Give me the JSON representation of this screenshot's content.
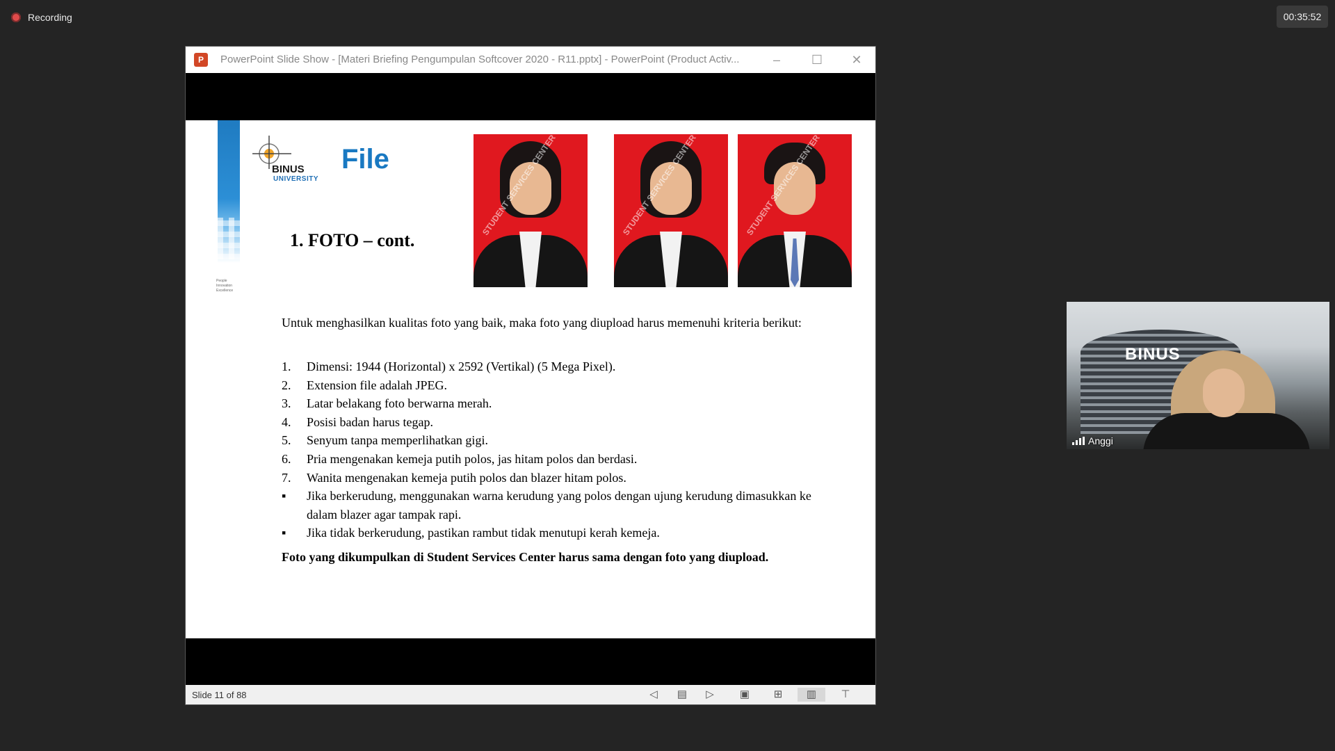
{
  "recording": {
    "label": "Recording"
  },
  "timer": {
    "value": "00:35:52"
  },
  "window": {
    "icon_glyph": "P",
    "title": "PowerPoint Slide Show - [Materi Briefing Pengumpulan Softcover 2020 - R11.pptx] - PowerPoint (Product Activ...",
    "minimize": "–",
    "maximize": "☐",
    "close": "✕"
  },
  "slide": {
    "logo_line1": "BINUS",
    "logo_line2": "UNIVERSITY",
    "tagline": [
      "People",
      "Innovation",
      "Excellence"
    ],
    "title": "File",
    "subtitle": "1. FOTO – cont.",
    "photo_watermark": "STUDENT SERVICES CENTER",
    "intro": "Untuk menghasilkan kualitas foto yang baik, maka foto yang diupload harus memenuhi kriteria berikut:",
    "criteria": [
      {
        "marker": "1.",
        "text": "Dimensi: 1944 (Horizontal) x 2592 (Vertikal) (5 Mega Pixel)."
      },
      {
        "marker": "2.",
        "text": "Extension file adalah JPEG."
      },
      {
        "marker": "3.",
        "text": "Latar belakang foto berwarna merah."
      },
      {
        "marker": "4.",
        "text": "Posisi badan harus tegap."
      },
      {
        "marker": "5.",
        "text": "Senyum tanpa memperlihatkan gigi."
      },
      {
        "marker": "6.",
        "text": "Pria mengenakan kemeja putih polos, jas hitam polos dan berdasi."
      },
      {
        "marker": "7.",
        "text": "Wanita mengenakan kemeja putih polos dan blazer hitam polos."
      },
      {
        "marker": "▪",
        "text": "Jika berkerudung, menggunakan warna kerudung yang polos dengan ujung kerudung dimasukkan ke dalam blazer agar tampak rapi."
      },
      {
        "marker": "▪",
        "text": "Jika tidak berkerudung, pastikan rambut tidak menutupi kerah kemeja."
      }
    ],
    "closing": "Foto yang dikumpulkan di Student Services Center harus sama dengan foto yang diupload."
  },
  "statusbar": {
    "counter": "Slide 11 of 88",
    "icons": {
      "prev": "previous-slide-icon",
      "notes": "notes-icon",
      "next": "next-slide-icon",
      "normal": "normal-view-icon",
      "sorter": "slide-sorter-icon",
      "reading": "reading-view-icon",
      "slideshow": "slideshow-icon"
    }
  },
  "participant": {
    "name": "Anggi",
    "background_brand": "BINUS"
  },
  "colors": {
    "desktop_bg": "#242424",
    "slide_title_blue": "#1979c2",
    "photo_bg_red": "#e0181f",
    "record_red": "#e04b4b"
  }
}
